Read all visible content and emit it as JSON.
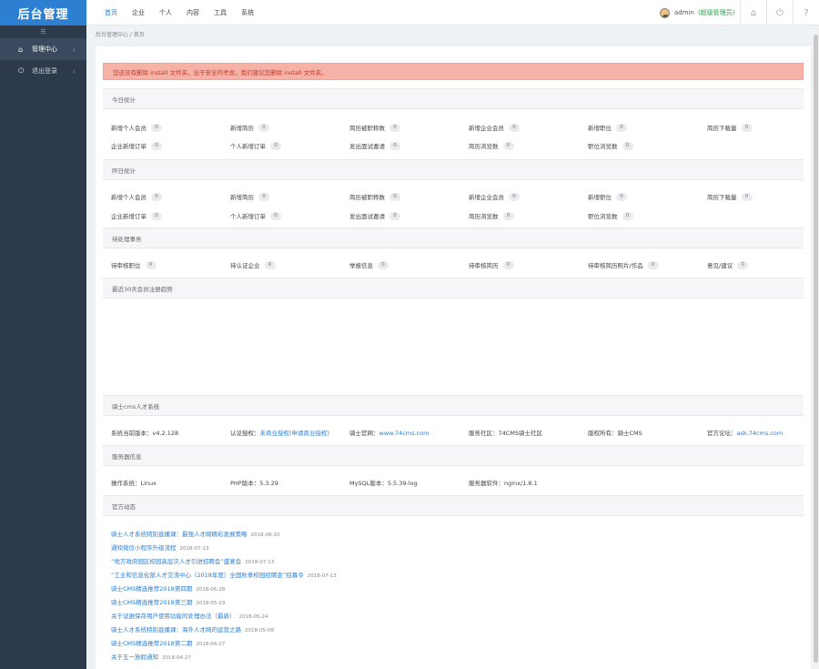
{
  "app": {
    "title": "后台管理"
  },
  "sidebar": {
    "toggle": "☰",
    "items": [
      {
        "label": "管理中心",
        "icon": "home-icon",
        "glyph": "⌂",
        "active": true
      },
      {
        "label": "退出登录",
        "icon": "power-icon",
        "glyph": "⏻",
        "active": false
      }
    ]
  },
  "nav": [
    "首页",
    "企业",
    "个人",
    "内容",
    "工具",
    "系统"
  ],
  "user": {
    "name": "admin",
    "role": "(超级管理员)"
  },
  "header_icons": [
    {
      "name": "home-icon",
      "glyph": "⌂"
    },
    {
      "name": "power-icon",
      "glyph": "⏻"
    },
    {
      "name": "help-icon",
      "glyph": "?"
    }
  ],
  "breadcrumb": "后台管理中心 / 首页",
  "alert": "您还没有删除 install 文件夹，出于安全的考虑，我们建议您删除 install 文件夹。",
  "today": {
    "title": "今日统计",
    "row1": [
      {
        "label": "新增个人会员",
        "value": "0"
      },
      {
        "label": "新增简历",
        "value": "0"
      },
      {
        "label": "简历被职称数",
        "value": "0"
      },
      {
        "label": "新增企业会员",
        "value": "0"
      },
      {
        "label": "新增职位",
        "value": "0"
      },
      {
        "label": "简历下载量",
        "value": "0"
      }
    ],
    "row2": [
      {
        "label": "企业新增订单",
        "value": "0"
      },
      {
        "label": "个人新增订单",
        "value": "0"
      },
      {
        "label": "发出面试邀请",
        "value": "0"
      },
      {
        "label": "简历浏览数",
        "value": "0"
      },
      {
        "label": "职位浏览数",
        "value": "0"
      }
    ]
  },
  "yesterday": {
    "title": "昨日统计",
    "row1": [
      {
        "label": "新增个人会员",
        "value": "0"
      },
      {
        "label": "新增简历",
        "value": "0"
      },
      {
        "label": "简历被职称数",
        "value": "0"
      },
      {
        "label": "新增企业会员",
        "value": "0"
      },
      {
        "label": "新增职位",
        "value": "0"
      },
      {
        "label": "简历下载量",
        "value": "0"
      }
    ],
    "row2": [
      {
        "label": "企业新增订单",
        "value": "0"
      },
      {
        "label": "个人新增订单",
        "value": "0"
      },
      {
        "label": "发出面试邀请",
        "value": "0"
      },
      {
        "label": "简历浏览数",
        "value": "0"
      },
      {
        "label": "职位浏览数",
        "value": "0"
      }
    ]
  },
  "pending": {
    "title": "待处理事务",
    "items": [
      {
        "label": "待审核职位",
        "value": "0"
      },
      {
        "label": "待认证企业",
        "value": "0"
      },
      {
        "label": "举报信息",
        "value": "0"
      },
      {
        "label": "待审核简历",
        "value": "0"
      },
      {
        "label": "待审核简历照片/作品",
        "value": "0"
      },
      {
        "label": "意见/建议",
        "value": "0"
      }
    ]
  },
  "trend": {
    "title": "最近30天会员注册趋势"
  },
  "system": {
    "title": "骑士cms人才系统",
    "version_label": "系统当前版本：",
    "version": "v4.2.128",
    "auth_label": "认证授权：",
    "auth": "未商业授权(申请商业授权)",
    "site_label": "骑士官网：",
    "site": "www.74cms.com",
    "forum_label": "服务社区：",
    "forum": "74CMS骑士社区",
    "owner_label": "版权所有：",
    "owner": "骑士CMS",
    "qa_label": "官方论坛：",
    "qa": "ask.74cms.com"
  },
  "server": {
    "title": "服务器信息",
    "os_label": "操作系统：",
    "os": "Linux",
    "php_label": "PHP版本：",
    "php": "5.3.29",
    "mysql_label": "MySQL版本：",
    "mysql": "5.5.39-log",
    "web_label": "服务器软件：",
    "web": "nginx/1.8.1"
  },
  "news": {
    "title": "官方动态",
    "items": [
      {
        "title": "骑士人才系统特别直播课：最强人才网精彩发展策略",
        "date": "2018-08-20"
      },
      {
        "title": "通知微信小程序升级流程",
        "date": "2018-07-13"
      },
      {
        "title": "“地方政府园区校园高层次人才引进招聘会”盛宴会",
        "date": "2018-07-13"
      },
      {
        "title": "“工业和信息化部人才交流中心（2018年度）全国秋季校园招聘会”招募令",
        "date": "2018-07-13"
      },
      {
        "title": "骑士CMS精选推荐2018第四期",
        "date": "2018-06-28"
      },
      {
        "title": "骑士CMS精选推荐2018第三期",
        "date": "2018-05-29"
      },
      {
        "title": "关于证据保存用户使用功能的处理办法（最新）",
        "date": "2018-05-24"
      },
      {
        "title": "骑士人才系统特别直播课：海外人才网的运营之路",
        "date": "2018-05-08"
      },
      {
        "title": "骑士CMS精选推荐2018第二期",
        "date": "2018-04-27"
      },
      {
        "title": "关于五一放假通知",
        "date": "2018-04-27"
      }
    ]
  }
}
